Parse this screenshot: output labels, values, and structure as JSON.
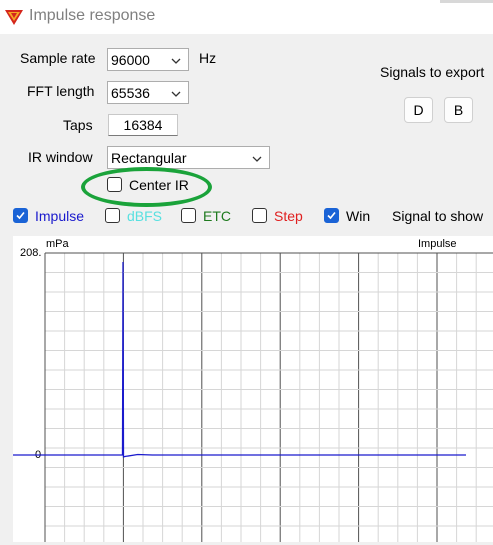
{
  "window": {
    "title": "Impulse response"
  },
  "form": {
    "sample_rate": {
      "label": "Sample rate",
      "value": "96000",
      "unit": "Hz"
    },
    "fft_length": {
      "label": "FFT length",
      "value": "65536"
    },
    "taps": {
      "label": "Taps",
      "value": "16384"
    },
    "ir_window": {
      "label": "IR window",
      "value": "Rectangular"
    },
    "center_ir": {
      "label": "Center IR",
      "checked": false
    }
  },
  "export": {
    "label": "Signals to export",
    "buttons": [
      "D",
      "B"
    ]
  },
  "signals": {
    "label": "Signal to show",
    "items": [
      {
        "label": "Impulse",
        "checked": true,
        "color": "#1a1acd"
      },
      {
        "label": "dBFS",
        "checked": false,
        "color": "#58e0e0"
      },
      {
        "label": "ETC",
        "checked": false,
        "color": "#1e7a1e"
      },
      {
        "label": "Step",
        "checked": false,
        "color": "#e02020"
      },
      {
        "label": "Win",
        "checked": true,
        "color": "#000000"
      }
    ]
  },
  "plot": {
    "unit": "mPa",
    "series_label": "Impulse",
    "y_top_label": "208.",
    "y_zero_label": "0"
  },
  "chart_data": {
    "type": "line",
    "title": "",
    "series": [
      {
        "name": "Impulse",
        "color": "#1a1acd",
        "x": [
          0,
          0.99,
          1.0,
          1.01,
          1.05,
          1.3,
          1.6,
          2.5,
          8
        ],
        "y": [
          0,
          0,
          208,
          -2,
          -1.5,
          0.5,
          0,
          0,
          0
        ]
      }
    ],
    "ylim": [
      -90,
      208
    ],
    "grid": true,
    "legend": "top-right"
  }
}
